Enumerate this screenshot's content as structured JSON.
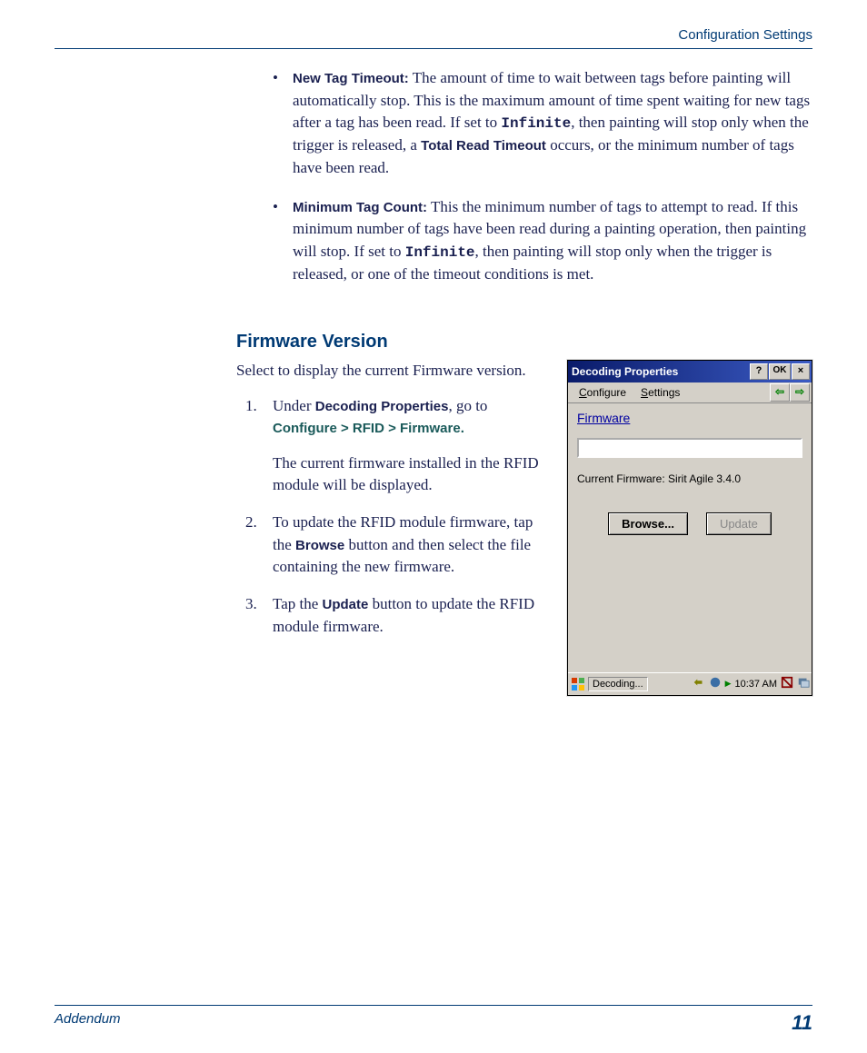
{
  "header": {
    "title": "Configuration Settings"
  },
  "bullet1": {
    "label": "New Tag Timeout:",
    "text_a": " The amount of time to wait between tags before painting will automatically stop. This is the maximum amount of time spent waiting for new tags after a tag has been read. If set to ",
    "mono1": "Infinite",
    "text_b": ", then painting will stop only when the trigger is released, a ",
    "label2": "Total Read Timeout",
    "text_c": " occurs, or the minimum number of tags have been read."
  },
  "bullet2": {
    "label": "Minimum Tag Count:",
    "text_a": " This the minimum number of tags to attempt to read. If this minimum number of tags have been read during a painting operation, then painting will stop. If set to ",
    "mono1": "Infinite",
    "text_b": ", then painting will stop only when the trigger is released, or one of the timeout conditions is met."
  },
  "section": {
    "heading": "Firmware Version",
    "intro": "Select to display the current Firmware version."
  },
  "steps": {
    "s1_a": "Under ",
    "s1_b": "Decoding Properties",
    "s1_c": ", go to ",
    "s1_d": "Configure > RFID > Firmware.",
    "s1_sub": "The current firmware installed in the RFID module will be displayed.",
    "s2_a": "To update the RFID module firmware, tap the ",
    "s2_b": "Browse",
    "s2_c": " button and then select the file containing the new firmware.",
    "s3_a": "Tap the ",
    "s3_b": "Update",
    "s3_c": " button to update the RFID module firmware."
  },
  "dialog": {
    "title": "Decoding Properties",
    "help": "?",
    "ok": "OK",
    "close": "×",
    "menu_configure": "Configure",
    "menu_settings": "Settings",
    "back": "⇦",
    "fwd": "⇨",
    "panel_title": "Firmware",
    "current": "Current Firmware: Sirit Agile 3.4.0",
    "browse": "Browse...",
    "update": "Update",
    "task_button": "Decoding...",
    "time": "10:37 AM"
  },
  "footer": {
    "label": "Addendum",
    "page": "11"
  }
}
